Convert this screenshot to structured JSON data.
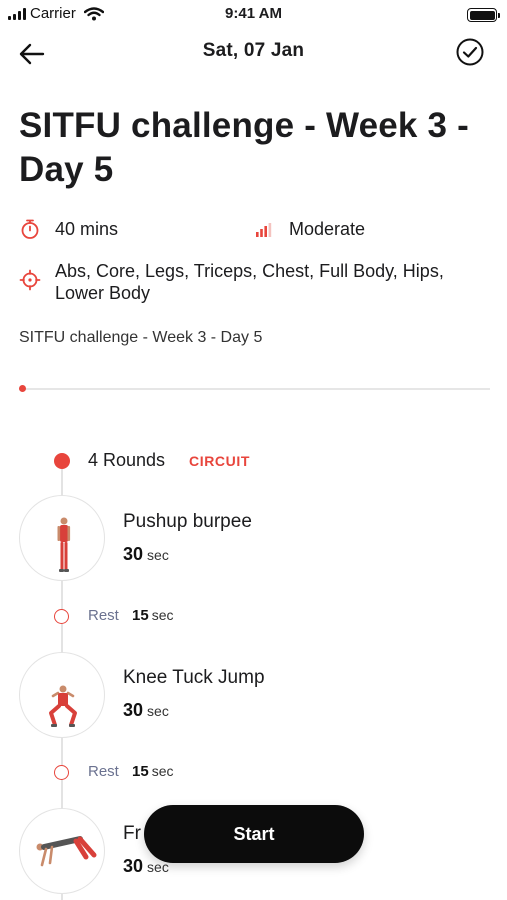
{
  "status_bar": {
    "carrier": "Carrier",
    "time": "9:41 AM"
  },
  "nav": {
    "title": "Sat, 07 Jan",
    "back_icon": "arrow-left-icon",
    "confirm_icon": "check-circle-icon"
  },
  "workout": {
    "title": "SITFU challenge - Week 3 - Day 5",
    "duration": "40 mins",
    "intensity": "Moderate",
    "targets": "Abs, Core, Legs, Triceps, Chest, Full Body, Hips, Lower Body",
    "subtitle": "SITFU challenge - Week 3 - Day 5",
    "progress_fraction": 0
  },
  "circuit": {
    "rounds": "4 Rounds",
    "type": "CIRCUIT",
    "exercises": [
      {
        "name": "Pushup burpee",
        "duration_value": "30",
        "duration_unit": "sec"
      },
      {
        "name": "Knee Tuck Jump",
        "duration_value": "30",
        "duration_unit": "sec"
      },
      {
        "name": "Fr",
        "duration_value": "30",
        "duration_unit": "sec"
      }
    ],
    "rests": [
      {
        "label": "Rest",
        "value": "15",
        "unit": "sec"
      },
      {
        "label": "Rest",
        "value": "15",
        "unit": "sec"
      }
    ]
  },
  "actions": {
    "start_label": "Start"
  },
  "colors": {
    "accent": "#e8453c",
    "rest_label": "#6b7290",
    "button": "#0c0c0c"
  }
}
